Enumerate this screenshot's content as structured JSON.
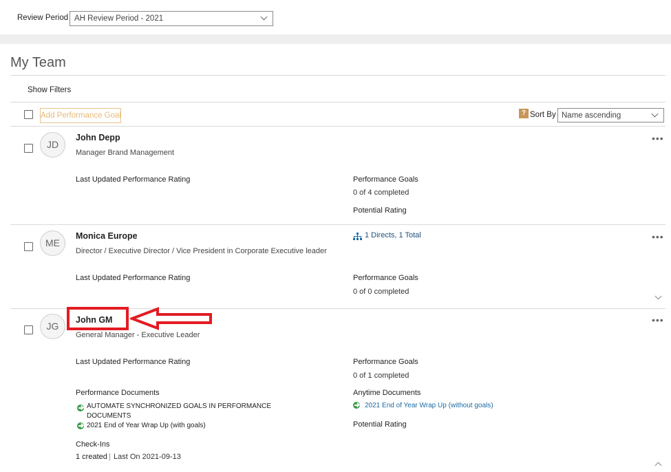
{
  "review_period": {
    "label": "Review Period",
    "selected": "AH Review Period - 2021"
  },
  "page_title": "My Team",
  "filters": {
    "show_filters": "Show Filters"
  },
  "toolbar": {
    "add_goal_label": "Add Performance Goal",
    "help_glyph": "?",
    "sort_label": "Sort By",
    "sort_selected": "Name ascending"
  },
  "members": [
    {
      "initials": "JD",
      "name": "John Depp",
      "title": "Manager Brand Management",
      "rating_label": "Last Updated Performance Rating",
      "goals_label": "Performance Goals",
      "goals_value": "0 of 4 completed",
      "potential_label": "Potential Rating"
    },
    {
      "initials": "ME",
      "name": "Monica Europe",
      "title": "Director / Executive Director / Vice President in Corporate Executive leader",
      "directs": "1 Directs, 1 Total",
      "rating_label": "Last Updated Performance Rating",
      "goals_label": "Performance Goals",
      "goals_value": "0 of 0 completed"
    },
    {
      "initials": "JG",
      "name": "John GM",
      "title": "General Manager - Executive Leader",
      "rating_label": "Last Updated Performance Rating",
      "goals_label": "Performance Goals",
      "goals_value": "0 of 1 completed",
      "perf_docs_label": "Performance Documents",
      "perf_docs": [
        "AUTOMATE SYNCHRONIZED GOALS IN PERFORMANCE DOCUMENTS",
        "2021 End of Year Wrap Up (with goals)"
      ],
      "anytime_docs_label": "Anytime Documents",
      "anytime_docs": [
        "2021 End of Year Wrap Up (without goals)"
      ],
      "potential_label": "Potential Rating",
      "checkins_label": "Check-Ins",
      "checkins_count": "1 created",
      "checkins_sep": "|",
      "checkins_last": "Last On  2021-09-13"
    }
  ],
  "more_glyph": "•••",
  "colors": {
    "annotation_red": "#e31b23",
    "link_blue": "#1a6aa5",
    "go_green": "#3a9b48",
    "disabled_orange": "#e8b877"
  }
}
